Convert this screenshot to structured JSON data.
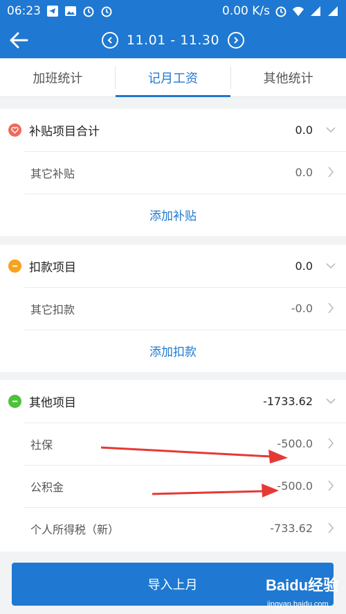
{
  "status_bar": {
    "time": "06:23",
    "network_speed": "0.00 K/s",
    "icons": [
      "telegram-icon",
      "image-icon",
      "alarm-icon",
      "alarm-icon",
      "alarm-icon",
      "wifi-icon",
      "signal-icon",
      "signal-icon"
    ]
  },
  "nav": {
    "date_range": "11.01 - 11.30"
  },
  "tabs": [
    {
      "label": "加班统计",
      "active": false
    },
    {
      "label": "记月工资",
      "active": true
    },
    {
      "label": "其他统计",
      "active": false
    }
  ],
  "sections": {
    "allowance": {
      "title": "补贴项目合计",
      "total": "0.0",
      "items": [
        {
          "label": "其它补贴",
          "value": "0.0"
        }
      ],
      "add_label": "添加补贴",
      "color": "#f06a5a"
    },
    "deduction": {
      "title": "扣款项目",
      "total": "0.0",
      "items": [
        {
          "label": "其它扣款",
          "value": "-0.0"
        }
      ],
      "add_label": "添加扣款",
      "color": "#f7a21b"
    },
    "other": {
      "title": "其他项目",
      "total": "-1733.62",
      "items": [
        {
          "label": "社保",
          "value": "-500.0"
        },
        {
          "label": "公积金",
          "value": "-500.0"
        },
        {
          "label": "个人所得税（新）",
          "value": "-733.62"
        }
      ],
      "color": "#4cc23a"
    }
  },
  "footer": {
    "import_label": "导入上月"
  },
  "watermark": {
    "brand": "Baidu经验",
    "url": "jingyan.baidu.com"
  },
  "colors": {
    "primary": "#1f78d1",
    "annotation_arrow": "#e53935"
  }
}
